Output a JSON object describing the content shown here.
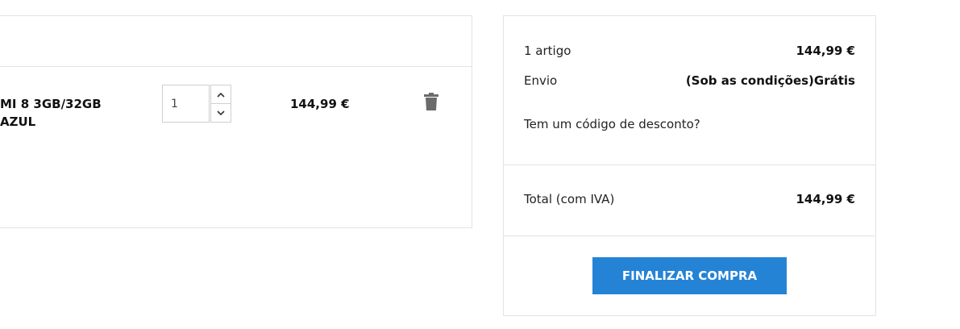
{
  "cart": {
    "product_name_line1": "MI 8 3GB/32GB",
    "product_name_line2": "AZUL",
    "quantity": "1",
    "price": "144,99 €",
    "icons": {
      "qty_up": "chevron-up-icon",
      "qty_down": "chevron-down-icon",
      "delete": "trash-icon"
    }
  },
  "summary": {
    "items_label": "1 artigo",
    "items_value": "144,99 €",
    "shipping_label": "Envio",
    "shipping_value": "(Sob as condições)Grátis",
    "discount_link": "Tem um código de desconto?",
    "total_label": "Total (com IVA)",
    "total_value": "144,99 €",
    "checkout_button": "FINALIZAR COMPRA"
  },
  "colors": {
    "accent": "#2583d6",
    "border": "#e3e3e3",
    "icon": "#6b6b6b"
  }
}
